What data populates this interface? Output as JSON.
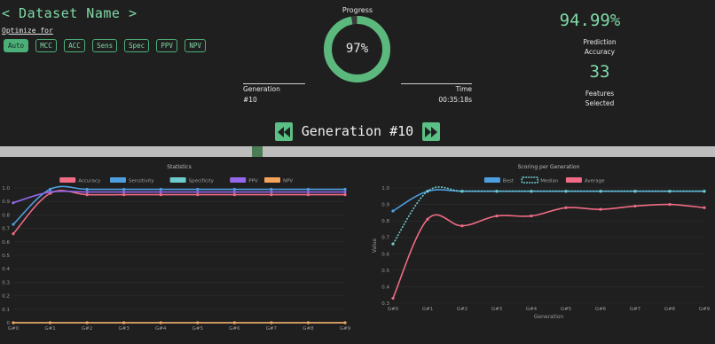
{
  "header": {
    "title": "< Dataset Name >",
    "optimize_label": "Optimize for",
    "options": [
      "Auto",
      "MCC",
      "ACC",
      "Sens",
      "Spec",
      "PPV",
      "NPV"
    ],
    "active_option": "Auto"
  },
  "progress": {
    "label": "Progress",
    "value_text": "97%",
    "fraction": 0.97,
    "ring_color": "#5cb97e",
    "generation_label": "Generation",
    "generation_value": "#10",
    "time_label": "Time",
    "time_value": "00:35:18s"
  },
  "summary": {
    "accuracy_value": "94.99%",
    "accuracy_label_line1": "Prediction",
    "accuracy_label_line2": "Accuracy",
    "features_value": "33",
    "features_label_line1": "Features",
    "features_label_line2": "Selected"
  },
  "navigation": {
    "generation_title": "Generation #10",
    "slider_fraction": 0.36
  },
  "chart_data": [
    {
      "type": "line",
      "title": "Statistics",
      "categories": [
        "G#0",
        "G#1",
        "G#2",
        "G#3",
        "G#4",
        "G#5",
        "G#6",
        "G#7",
        "G#8",
        "G#9"
      ],
      "ylim": [
        0,
        1.0
      ],
      "yticks": [
        "0",
        "0.1",
        "0.2",
        "0.3",
        "0.4",
        "0.5",
        "0.6",
        "0.7",
        "0.8",
        "0.9",
        "1.0"
      ],
      "legend_position": "top",
      "series": [
        {
          "name": "Accuracy",
          "color": "#f06b86",
          "values": [
            0.66,
            0.96,
            0.95,
            0.95,
            0.95,
            0.95,
            0.95,
            0.95,
            0.95,
            0.95
          ]
        },
        {
          "name": "Sensitivity",
          "color": "#4d9fe0",
          "values": [
            0.73,
            0.99,
            0.99,
            0.99,
            0.99,
            0.99,
            0.99,
            0.99,
            0.99,
            0.99
          ]
        },
        {
          "name": "Specificity",
          "color": "#6ecbcb",
          "values": [
            0.0,
            0.0,
            0.0,
            0.0,
            0.0,
            0.0,
            0.0,
            0.0,
            0.0,
            0.0
          ]
        },
        {
          "name": "PPV",
          "color": "#9468ea",
          "values": [
            0.89,
            0.97,
            0.97,
            0.97,
            0.97,
            0.97,
            0.97,
            0.97,
            0.97,
            0.97
          ]
        },
        {
          "name": "NPV",
          "color": "#f5a35a",
          "values": [
            0.0,
            0.0,
            0.0,
            0.0,
            0.0,
            0.0,
            0.0,
            0.0,
            0.0,
            0.0
          ]
        }
      ]
    },
    {
      "type": "line",
      "title": "Scoring per Generation",
      "categories": [
        "G#0",
        "G#1",
        "G#2",
        "G#3",
        "G#4",
        "G#5",
        "G#6",
        "G#7",
        "G#8",
        "G#9"
      ],
      "xlabel": "Generation",
      "ylabel": "Value",
      "ylim": [
        0.3,
        1.0
      ],
      "yticks": [
        "0.3",
        "0.4",
        "0.5",
        "0.6",
        "0.7",
        "0.8",
        "0.9",
        "1.0"
      ],
      "legend_position": "top",
      "series": [
        {
          "name": "Best",
          "color": "#4d9fe0",
          "values": [
            0.86,
            0.98,
            0.98,
            0.98,
            0.98,
            0.98,
            0.98,
            0.98,
            0.98,
            0.98
          ]
        },
        {
          "name": "Median",
          "color": "#6ecbcb",
          "dashed": true,
          "values": [
            0.66,
            0.98,
            0.98,
            0.98,
            0.98,
            0.98,
            0.98,
            0.98,
            0.98,
            0.98
          ]
        },
        {
          "name": "Average",
          "color": "#f06b86",
          "values": [
            0.33,
            0.81,
            0.77,
            0.83,
            0.83,
            0.88,
            0.87,
            0.89,
            0.9,
            0.88
          ]
        }
      ]
    }
  ]
}
